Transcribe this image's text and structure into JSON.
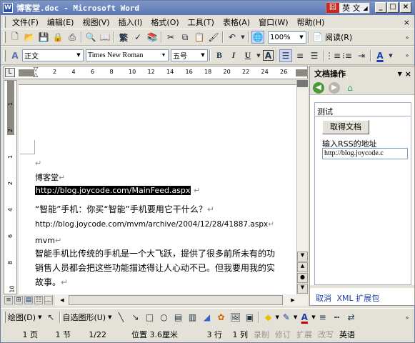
{
  "window": {
    "title": "博客堂.doc - Microsoft Word",
    "app_icon": "W",
    "lang_label": "英 文"
  },
  "menu": [
    "文件(F)",
    "编辑(E)",
    "视图(V)",
    "插入(I)",
    "格式(O)",
    "工具(T)",
    "表格(A)",
    "窗口(W)",
    "帮助(H)"
  ],
  "toolbar": {
    "zoom": "100%",
    "read_label": "阅读(R)",
    "style": "正文",
    "font": "Times New Roman",
    "size": "五号",
    "bold": "B",
    "italic": "I",
    "underline": "U"
  },
  "ruler": {
    "ticks": [
      "2",
      "4",
      "6",
      "8",
      "10",
      "12",
      "14",
      "16",
      "18",
      "20",
      "22",
      "24",
      "26"
    ]
  },
  "vruler": {
    "ticks": [
      "1",
      "2",
      "1",
      "2",
      "4",
      "6",
      "8",
      "10"
    ]
  },
  "document": {
    "line1": "博客堂",
    "line2": "http://blog.joycode.com/MainFeed.aspx",
    "line3": "“智能”手机：你买“智能”手机要用它干什么？",
    "line4": "http://blog.joycode.com/mvm/archive/2004/12/28/41887.aspx",
    "line5": "mvm",
    "line6": "智能手机比传统的手机是一个大飞跃，提供了很多前所未有的功",
    "line7": "销售人员都会把这些功能描述得让人心动不已。但我要用我的实",
    "line8": "故事。"
  },
  "taskpane": {
    "title": "文档操作",
    "section": "测试",
    "get_doc": "取得文档",
    "rss_label": "输入RSS的地址",
    "rss_value": "http://blog.joycode.c",
    "cancel": "取消",
    "xml": "XML 扩展包"
  },
  "drawbar": {
    "draw": "绘图(D)",
    "autoshape": "自选图形(U)"
  },
  "status": {
    "page": "1 页",
    "section": "1 节",
    "pages": "1/22",
    "pos": "位置 3.6厘米",
    "line": "3 行",
    "col": "1 列",
    "rec": "录制",
    "trk": "修订",
    "ext": "扩展",
    "ovr": "改写",
    "lang": "英语"
  }
}
